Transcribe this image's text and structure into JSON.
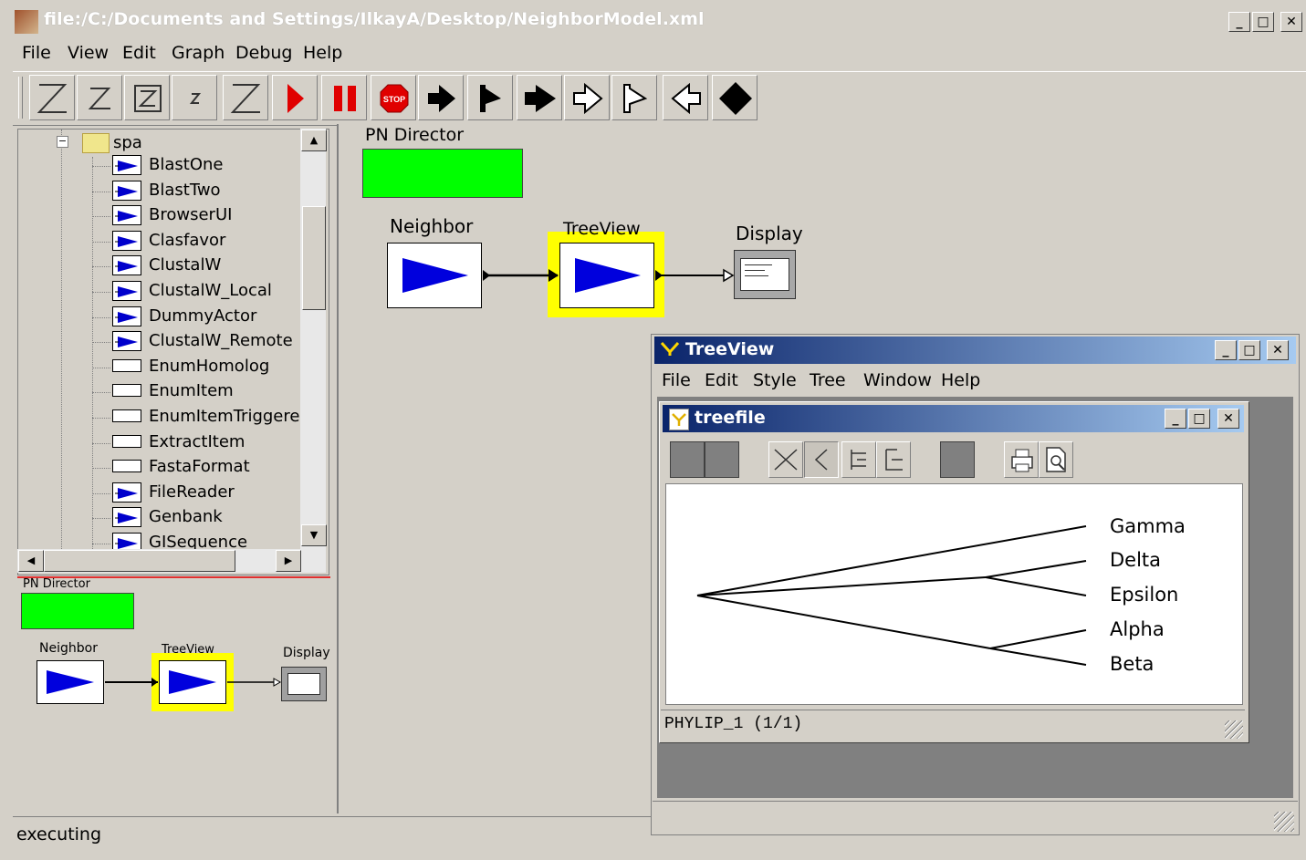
{
  "window": {
    "title": "file:/C:/Documents and Settings/IlkayA/Desktop/NeighborModel.xml",
    "min": "_",
    "max": "□",
    "close": "✕"
  },
  "menubar": [
    "File",
    "View",
    "Edit",
    "Graph",
    "Debug",
    "Help"
  ],
  "toolbar": {
    "buttons": [
      "zoom-reset-icon",
      "zoom-in-icon",
      "zoom-fit-icon",
      "zoom-out-icon",
      "zoom-full-icon",
      "run-icon",
      "pause-icon",
      "stop-icon",
      "arrow-right-icon",
      "flag-icon",
      "arrow-right-bold-icon",
      "arrow-right-outline-icon",
      "flag-outline-icon",
      "arrow-left-outline-icon",
      "diamond-icon"
    ],
    "stop_text": "STOP"
  },
  "tree": {
    "folder": "spa",
    "items": [
      {
        "label": "BlastOne",
        "icon": "actor"
      },
      {
        "label": "BlastTwo",
        "icon": "actor"
      },
      {
        "label": "BrowserUI",
        "icon": "actor"
      },
      {
        "label": "Clasfavor",
        "icon": "actor"
      },
      {
        "label": "ClustalW",
        "icon": "actor"
      },
      {
        "label": "ClustalW_Local",
        "icon": "actor"
      },
      {
        "label": "DummyActor",
        "icon": "actor"
      },
      {
        "label": "ClustalW_Remote",
        "icon": "actor"
      },
      {
        "label": "EnumHomolog",
        "icon": "blank"
      },
      {
        "label": "EnumItem",
        "icon": "blank"
      },
      {
        "label": "EnumItemTriggered",
        "icon": "blank"
      },
      {
        "label": "ExtractItem",
        "icon": "blank"
      },
      {
        "label": "FastaFormat",
        "icon": "blank"
      },
      {
        "label": "FileReader",
        "icon": "actor"
      },
      {
        "label": "Genbank",
        "icon": "actor"
      },
      {
        "label": "GISequence",
        "icon": "actor"
      }
    ]
  },
  "overview": {
    "director": "PN Director",
    "neighbor": "Neighbor",
    "treeview": "TreeView",
    "display": "Display"
  },
  "canvas": {
    "director": "PN Director",
    "neighbor": "Neighbor",
    "treeview": "TreeView",
    "display": "Display",
    "director_color": "#00ff00",
    "highlight_color": "#ffff00"
  },
  "treeview_window": {
    "title": "TreeView",
    "menu": [
      "File",
      "Edit",
      "Style",
      "Tree",
      "Window",
      "Help"
    ],
    "min": "_",
    "max": "□",
    "close": "✕"
  },
  "treefile": {
    "title": "treefile",
    "min": "_",
    "max": "□",
    "close": "✕",
    "leaves": [
      "Gamma",
      "Delta",
      "Epsilon",
      "Alpha",
      "Beta"
    ],
    "status": "PHYLIP_1  (1/1)"
  },
  "statusbar": "executing"
}
